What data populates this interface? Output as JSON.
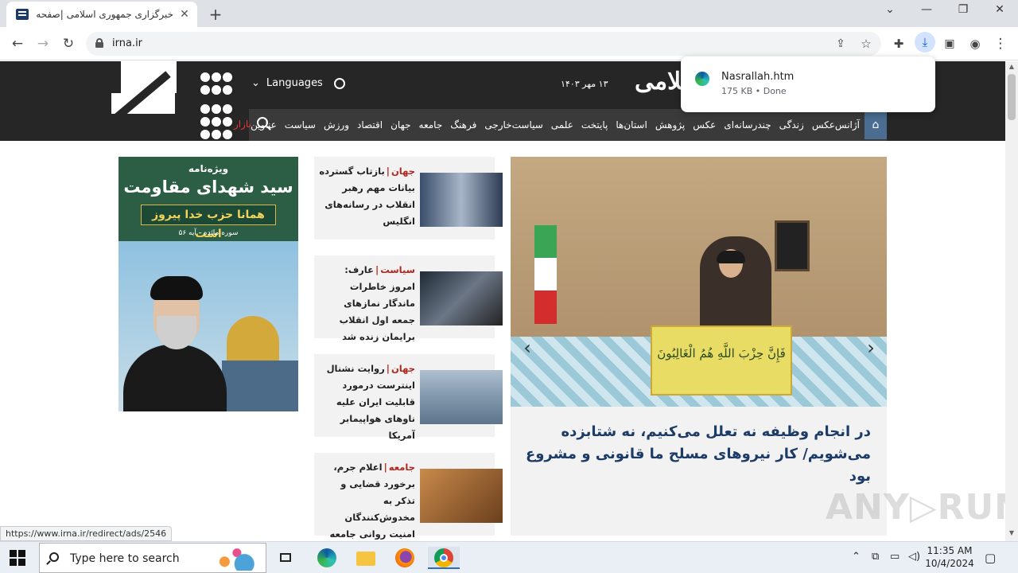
{
  "browser": {
    "tab_title": "خبرگزاری جمهوری اسلامی |صفحه اصلی",
    "tab_close": "✕",
    "new_tab": "+",
    "win_min": "—",
    "win_restore": "❐",
    "win_close": "✕",
    "tab_search": "⌄",
    "url": "irna.ir",
    "status_url": "https://www.irna.ir/redirect/ads/2546"
  },
  "download": {
    "file_name": "Nasrallah.htm",
    "meta": "175 KB • Done"
  },
  "site": {
    "name": "خبرگزاری جمهوری اسلامی",
    "date": "۱۳ مهر ۱۴۰۳",
    "languages": "Languages",
    "bazar": "بازار",
    "home_icon": "⌂",
    "nav": [
      "عناوین",
      "سیاست",
      "ورزش",
      "اقتصاد",
      "جهان",
      "جامعه",
      "فرهنگ",
      "سیاست‌خارجی",
      "علمی",
      "پایتخت",
      "استان‌ها",
      "پژوهش",
      "عکس",
      "چندرسانه‌ای",
      "زندگی",
      "آژانس‌عکس"
    ]
  },
  "hero": {
    "caption": "در انجام وظیفه نه تعلل می‌کنیم، نه شتابزده می‌شویم/ کار نیروهای مسلح ما قانونی و مشروع بود",
    "banner_text": "فَإِنَّ حِزْبَ اللَّهِ هُمُ الْغَالِبُونَ",
    "prev": "‹",
    "next": "›"
  },
  "news": [
    {
      "cat": "جهان",
      "text": "بازتاب گسترده بیانات مهم رهبر انقلاب در رسانه‌های انگلیس"
    },
    {
      "cat": "سیاست",
      "text": "عارف: امروز خاطرات ماندگار نمازهای جمعه اول انقلاب برایمان زنده شد"
    },
    {
      "cat": "جهان",
      "text": "روایت نشنال اینترست درمورد قابلیت ایران علیه ناوهای هواپیمابر آمریکا"
    },
    {
      "cat": "جامعه",
      "text": "اعلام جرم، برخورد قضایی و تذکر به مخدوش‌کنندگان امنیت روانی جامعه"
    }
  ],
  "ad": {
    "t1": "ویژه‌نامه",
    "t2": "سید شهدای مقاومت",
    "t3": "همانا حزب خدا پیروز است",
    "t4": "سوره مائده - آیه ۵۶"
  },
  "watermark": "ANY▷RUN",
  "taskbar": {
    "search_placeholder": "Type here to search",
    "time": "11:35 AM",
    "date": "10/4/2024"
  }
}
